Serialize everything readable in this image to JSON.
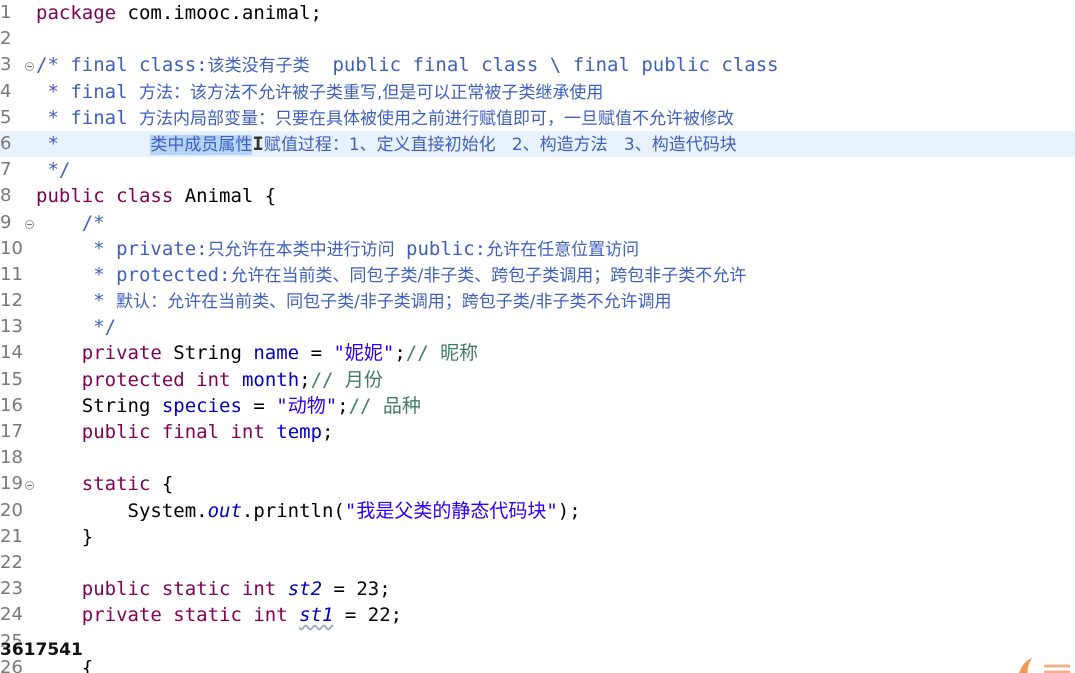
{
  "editor": {
    "lines": [
      {
        "num": "1",
        "parts": [
          {
            "t": "package",
            "c": "kw"
          },
          {
            "t": " com.imooc.animal;"
          }
        ]
      },
      {
        "num": "2",
        "parts": []
      },
      {
        "num": "3",
        "fold": true,
        "parts": [
          {
            "t": "/* final class:",
            "c": "cm"
          },
          {
            "t": "该类没有子类",
            "c": "cm cm-cjk"
          },
          {
            "t": "  public final class \\ final public class",
            "c": "cm"
          }
        ]
      },
      {
        "num": "4",
        "parts": [
          {
            "t": " * final ",
            "c": "cm"
          },
          {
            "t": "方法：该方法不允许被子类重写,但是可以正常被子类继承使用",
            "c": "cm cm-cjk"
          }
        ]
      },
      {
        "num": "5",
        "parts": [
          {
            "t": " * final ",
            "c": "cm"
          },
          {
            "t": "方法内局部变量：只要在具体被使用之前进行赋值即可，一旦赋值不允许被修改",
            "c": "cm cm-cjk"
          }
        ]
      },
      {
        "num": "6",
        "current": true,
        "parts": [
          {
            "t": " *        ",
            "c": "cm"
          },
          {
            "t": "类中成员属性",
            "c": "cm cm-cjk sel"
          },
          {
            "t": "I",
            "c": "caret-ibeam"
          },
          {
            "t": "赋值过程：1、定义直接初始化   2、构造方法   3、构造代码块",
            "c": "cm cm-cjk"
          }
        ]
      },
      {
        "num": "7",
        "parts": [
          {
            "t": " */",
            "c": "cm"
          }
        ]
      },
      {
        "num": "8",
        "parts": [
          {
            "t": "public class",
            "c": "kw"
          },
          {
            "t": " Animal {"
          }
        ]
      },
      {
        "num": "9",
        "fold": true,
        "parts": [
          {
            "t": "    /*",
            "c": "cm"
          }
        ]
      },
      {
        "num": "10",
        "parts": [
          {
            "t": "     * private:",
            "c": "cm"
          },
          {
            "t": "只允许在本类中进行访问",
            "c": "cm cm-cjk"
          },
          {
            "t": " public:",
            "c": "cm"
          },
          {
            "t": "允许在任意位置访问",
            "c": "cm cm-cjk"
          }
        ]
      },
      {
        "num": "11",
        "parts": [
          {
            "t": "     * protected:",
            "c": "cm"
          },
          {
            "t": "允许在当前类、同包子类/非子类、跨包子类调用；跨包非子类不允许",
            "c": "cm cm-cjk"
          }
        ]
      },
      {
        "num": "12",
        "parts": [
          {
            "t": "     * ",
            "c": "cm"
          },
          {
            "t": "默认：允许在当前类、同包子类/非子类调用；跨包子类/非子类不允许调用",
            "c": "cm cm-cjk"
          }
        ]
      },
      {
        "num": "13",
        "parts": [
          {
            "t": "     */",
            "c": "cm"
          }
        ]
      },
      {
        "num": "14",
        "parts": [
          {
            "t": "    "
          },
          {
            "t": "private",
            "c": "kw"
          },
          {
            "t": " String "
          },
          {
            "t": "name",
            "c": "fld"
          },
          {
            "t": " = "
          },
          {
            "t": "\"妮妮\"",
            "c": "str"
          },
          {
            "t": ";"
          },
          {
            "t": "// 昵称",
            "c": "slc"
          }
        ]
      },
      {
        "num": "15",
        "parts": [
          {
            "t": "    "
          },
          {
            "t": "protected int",
            "c": "kw"
          },
          {
            "t": " "
          },
          {
            "t": "month",
            "c": "fld"
          },
          {
            "t": ";"
          },
          {
            "t": "// 月份",
            "c": "slc"
          }
        ]
      },
      {
        "num": "16",
        "parts": [
          {
            "t": "    String "
          },
          {
            "t": "species",
            "c": "fld"
          },
          {
            "t": " = "
          },
          {
            "t": "\"动物\"",
            "c": "str"
          },
          {
            "t": ";"
          },
          {
            "t": "// 品种",
            "c": "slc"
          }
        ]
      },
      {
        "num": "17",
        "parts": [
          {
            "t": "    "
          },
          {
            "t": "public final int",
            "c": "kw"
          },
          {
            "t": " "
          },
          {
            "t": "temp",
            "c": "fld"
          },
          {
            "t": ";"
          }
        ]
      },
      {
        "num": "18",
        "parts": []
      },
      {
        "num": "19",
        "fold": true,
        "parts": [
          {
            "t": "    "
          },
          {
            "t": "static",
            "c": "kw"
          },
          {
            "t": " {"
          }
        ]
      },
      {
        "num": "20",
        "parts": [
          {
            "t": "        System."
          },
          {
            "t": "out",
            "c": "sfld"
          },
          {
            "t": ".println("
          },
          {
            "t": "\"我是父类的静态代码块\"",
            "c": "str"
          },
          {
            "t": ");"
          }
        ]
      },
      {
        "num": "21",
        "parts": [
          {
            "t": "    }"
          }
        ]
      },
      {
        "num": "22",
        "parts": []
      },
      {
        "num": "23",
        "parts": [
          {
            "t": "    "
          },
          {
            "t": "public static int",
            "c": "kw"
          },
          {
            "t": " "
          },
          {
            "t": "st2",
            "c": "sfld"
          },
          {
            "t": " = 23;"
          }
        ]
      },
      {
        "num": "24",
        "parts": [
          {
            "t": "    "
          },
          {
            "t": "private static int",
            "c": "kw"
          },
          {
            "t": " "
          },
          {
            "t": "st1",
            "c": "sfld wavy"
          },
          {
            "t": " = 22;"
          }
        ]
      },
      {
        "num": "25",
        "parts": []
      },
      {
        "num": "26",
        "parts": [
          {
            "t": "    {"
          }
        ]
      }
    ]
  },
  "watermark": "3617541",
  "colors": {
    "keyword": "#7f0055",
    "comment": "#3f5fbf",
    "string": "#2a00ff",
    "field": "#0000c0",
    "line_comment": "#3f7f5f",
    "selection": "#b5d5ff",
    "current_line": "#e8f2fe",
    "line_number": "#787878"
  }
}
